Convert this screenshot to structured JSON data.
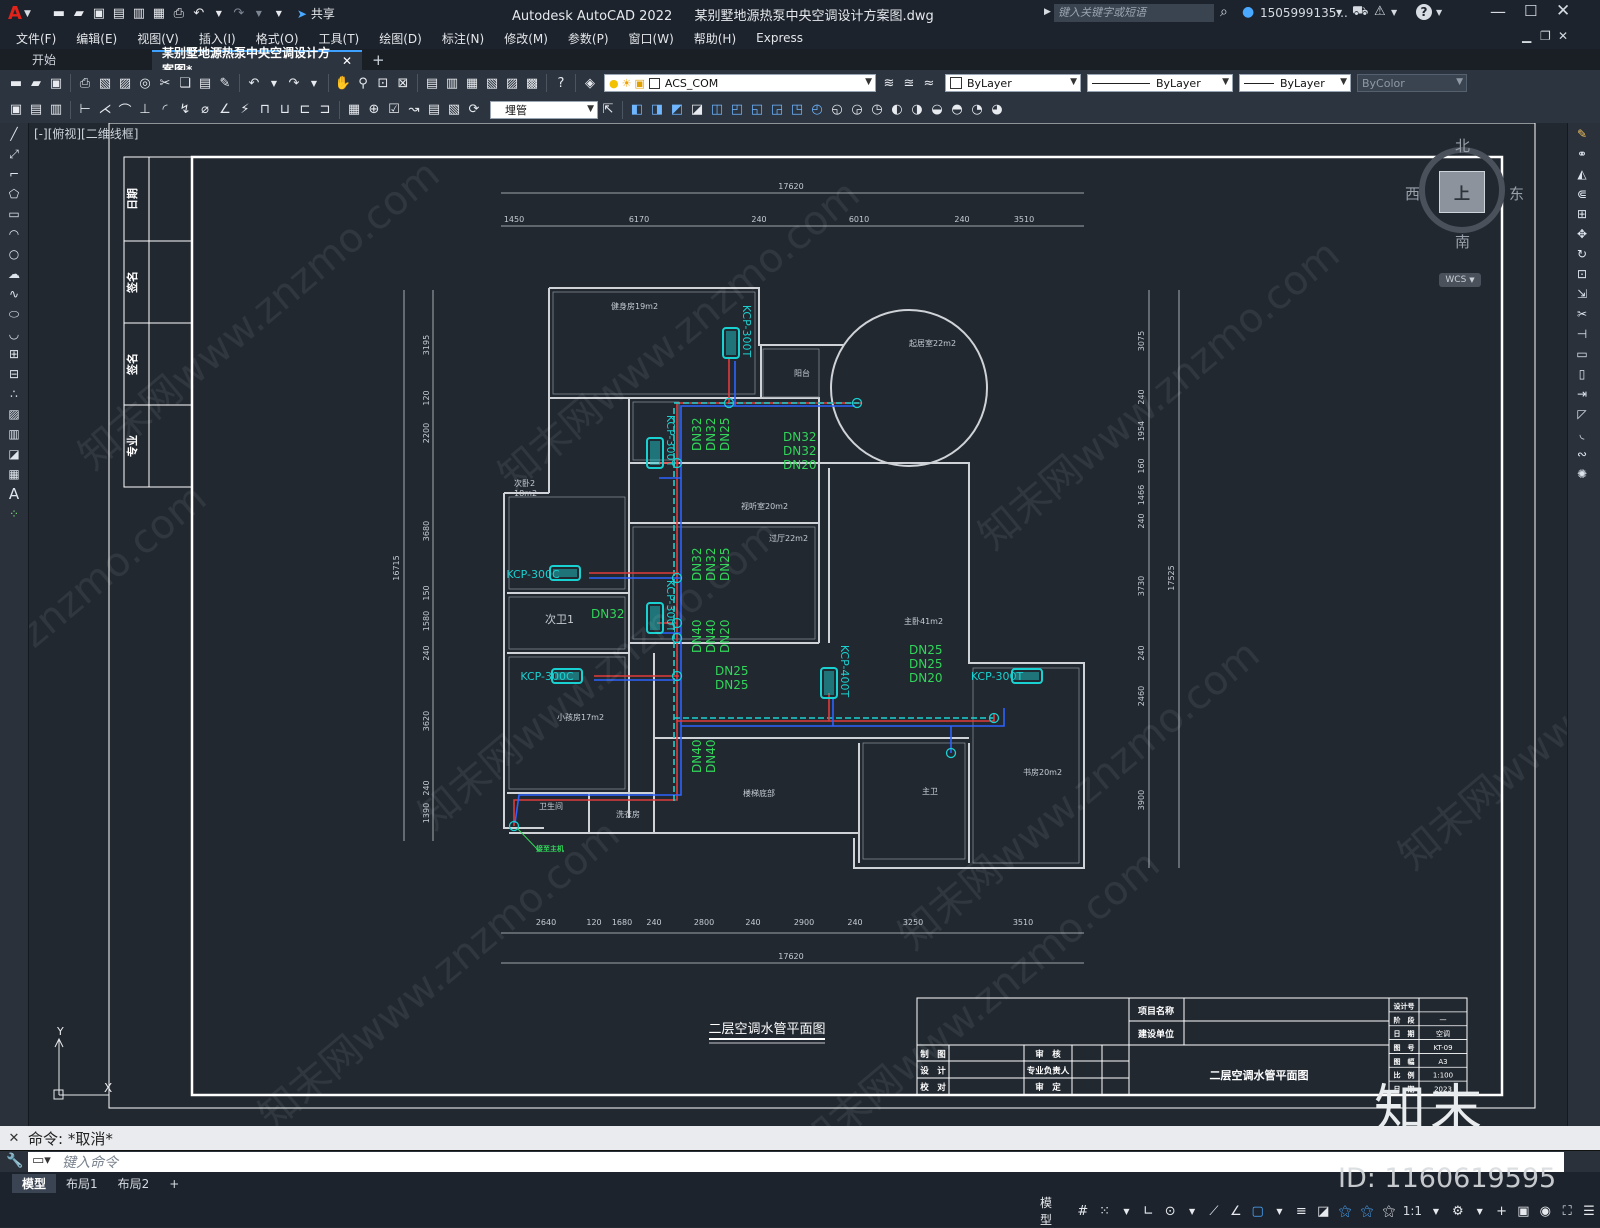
{
  "app": {
    "logo": "A",
    "title_app": "Autodesk AutoCAD 2022",
    "title_file": "某别墅地源热泵中央空调设计方案图.dwg",
    "share_label": "共享",
    "search_placeholder": "键入关键字或短语",
    "user": "1505999135...",
    "help": "?"
  },
  "menu": [
    "文件(F)",
    "编辑(E)",
    "视图(V)",
    "插入(I)",
    "格式(O)",
    "工具(T)",
    "绘图(D)",
    "标注(N)",
    "修改(M)",
    "参数(P)",
    "窗口(W)",
    "帮助(H)",
    "Express"
  ],
  "tabs": {
    "start": "开始",
    "doc": "某别墅地源热泵中央空调设计方案图*",
    "add": "+"
  },
  "props": {
    "layer": "ACS_COM",
    "color": "ByLayer",
    "linetype": "ByLayer",
    "lineweight": "ByLayer",
    "plotstyle": "ByColor",
    "pipe_style": "埋管"
  },
  "viewport_label": "[-][俯视][二维线框]",
  "viewcube": {
    "north": "北",
    "south": "南",
    "east": "东",
    "west": "西",
    "top": "上",
    "wcs": "WCS"
  },
  "ucs": {
    "x": "X",
    "y": "Y"
  },
  "drawing": {
    "side_table": [
      "日期",
      "签名",
      "签名",
      "专业"
    ],
    "top_total": "17620",
    "top_dims": [
      "1450",
      "6170",
      "240",
      "6010",
      "240",
      "3510"
    ],
    "bottom_total": "17620",
    "bottom_dims": [
      "2640",
      "120",
      "1680",
      "240",
      "2800",
      "240",
      "2900",
      "240",
      "3250",
      "3510"
    ],
    "left_total": "16715",
    "left_dims": [
      "3195",
      "120",
      "2200",
      "3680",
      "150",
      "1580",
      "240",
      "3620",
      "240",
      "1390"
    ],
    "right_total": "17525",
    "right_dims": [
      "3075",
      "240",
      "1954",
      "160",
      "1466",
      "240",
      "3730",
      "240",
      "2460",
      "3900"
    ],
    "rooms": [
      "健身房19m2",
      "起居室22m2",
      "阳台",
      "次卧2",
      "18m2",
      "视听室20m2",
      "过厅22m2",
      "次卫1",
      "主卧41m2",
      "小孩房17m2",
      "卫生间",
      "洗衣房",
      "楼梯底部",
      "主卫",
      "书房20m2"
    ],
    "units": [
      "KCP-300T",
      "KCP-300T",
      "KCP-300C",
      "KCP-300T",
      "KCP-300C",
      "KCP-400T",
      "KCP-300T"
    ],
    "pipes": [
      "DN32",
      "DN32",
      "DN25",
      "DN32",
      "DN32",
      "DN20",
      "DN32",
      "DN32",
      "DN25",
      "DN32",
      "DN40",
      "DN40",
      "DN20",
      "DN25",
      "DN25",
      "DN25",
      "DN25",
      "DN20",
      "DN40",
      "DN40"
    ],
    "riser_label": "接至主机",
    "plan_title": "二层空调水管平面图",
    "title_block": {
      "proj_name": "项目名称",
      "build_unit": "建设单位",
      "rows_left": [
        "制　图",
        "设　计",
        "校　对"
      ],
      "rows_mid": [
        "审　核",
        "专业负责人",
        "审　定"
      ],
      "drawing_title": "二层空调水管平面图",
      "right_labels": [
        "设计号",
        "阶　段",
        "日　期",
        "图　号",
        "图　幅",
        "比　例",
        "日　期"
      ],
      "right_values": [
        "",
        "一",
        "空调",
        "KT-09",
        "A3",
        "1:100",
        "2023"
      ]
    }
  },
  "command": {
    "prompt": "命令: *取消*",
    "input_placeholder": "键入命令"
  },
  "layouts": [
    "模型",
    "布局1",
    "布局2",
    "+"
  ],
  "status": {
    "model": "模型",
    "scale": "1:1"
  },
  "watermark": {
    "text": "znzmo.com",
    "site": "知末网www.znzmo.com",
    "logo": "知末",
    "id": "ID: 1160619595"
  }
}
